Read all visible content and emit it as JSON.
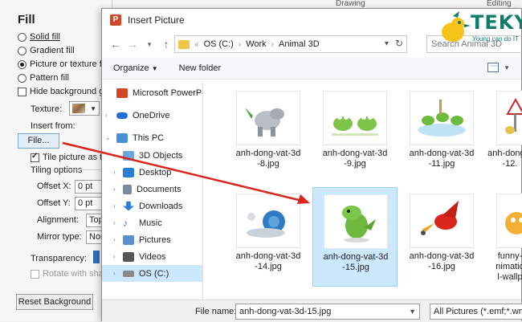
{
  "ribbon": {
    "drawing": "Drawing",
    "editing": "Editing"
  },
  "pane": {
    "title": "Fill",
    "options": [
      {
        "label": "Solid fill",
        "selected": false
      },
      {
        "label": "Gradient fill",
        "selected": false
      },
      {
        "label": "Picture or texture fill",
        "selected": true
      },
      {
        "label": "Pattern fill",
        "selected": false
      }
    ],
    "hide_background": "Hide background graphics",
    "texture_label": "Texture:",
    "insert_from": "Insert from:",
    "file_button": "File...",
    "tile_picture": "Tile picture as texture",
    "tiling_options": "Tiling options",
    "offset_x_label": "Offset X:",
    "offset_x_value": "0 pt",
    "offset_y_label": "Offset Y:",
    "offset_y_value": "0 pt",
    "alignment_label": "Alignment:",
    "alignment_value": "Top left",
    "mirror_label": "Mirror type:",
    "mirror_value": "None",
    "transparency_label": "Transparency:",
    "rotate_with_shape": "Rotate with shape",
    "reset_button": "Reset Background"
  },
  "dialog": {
    "title": "Insert Picture",
    "app_icon_letter": "P",
    "address": {
      "prefix": "«",
      "parts": [
        "OS (C:)",
        "Work",
        "Animal 3D"
      ]
    },
    "search_placeholder": "Search Animal 3D",
    "toolbar": {
      "organize": "Organize",
      "new_folder": "New folder"
    },
    "nav_items": [
      {
        "label": "Microsoft PowerPoint",
        "icon": "powerpoint-icon",
        "color": "#d24726"
      },
      {
        "label": "OneDrive",
        "icon": "cloud-icon",
        "color": "#1e6fd9"
      },
      {
        "label": "This PC",
        "icon": "computer-icon",
        "color": "#4a90d9"
      },
      {
        "label": "3D Objects",
        "icon": "cube-icon",
        "color": "#6aa7e0"
      },
      {
        "label": "Desktop",
        "icon": "desktop-icon",
        "color": "#2a7fd4"
      },
      {
        "label": "Documents",
        "icon": "document-icon",
        "color": "#7a8aa0"
      },
      {
        "label": "Downloads",
        "icon": "download-icon",
        "color": "#2a7fd4"
      },
      {
        "label": "Music",
        "icon": "music-icon",
        "color": "#3b78c8"
      },
      {
        "label": "Pictures",
        "icon": "pictures-icon",
        "color": "#5b8fd0"
      },
      {
        "label": "Videos",
        "icon": "video-icon",
        "color": "#555555"
      },
      {
        "label": "OS (C:)",
        "icon": "drive-icon",
        "color": "#8a8a8a"
      }
    ],
    "files": [
      {
        "name1": "anh-dong-vat-3d",
        "name2": "-8.jpg",
        "thumb": "dragon-icon",
        "selected": false
      },
      {
        "name1": "anh-dong-vat-3d",
        "name2": "-9.jpg",
        "thumb": "frogs-icon",
        "selected": false
      },
      {
        "name1": "anh-dong-vat-3d",
        "name2": "-11.jpg",
        "thumb": "frogs-pond-icon",
        "selected": false
      },
      {
        "name1": "anh-dong-v",
        "name2": "-12.",
        "thumb": "bird-icon",
        "selected": false
      },
      {
        "name1": "anh-dong-vat-3d",
        "name2": "-14.jpg",
        "thumb": "snail-icon",
        "selected": false
      },
      {
        "name1": "anh-dong-vat-3d",
        "name2": "-15.jpg",
        "thumb": "green-dragon-icon",
        "selected": true
      },
      {
        "name1": "anh-dong-vat-3d",
        "name2": "-16.jpg",
        "thumb": "red-dragon-icon",
        "selected": false
      },
      {
        "name1": "funny-",
        "name2": "nimatio",
        "name3": "l-wallp",
        "thumb": "cartoon-icon",
        "selected": false
      }
    ],
    "filename_label": "File name:",
    "filename_value": "anh-dong-vat-3d-15.jpg",
    "filetype_value": "All Pictures (*.emf;*.wmf;*.jpg"
  },
  "logo": {
    "text": "TEKY",
    "tagline": "Young can do IT",
    "color": "#0f7c6c"
  },
  "colors": {
    "selection": "#cce8ff",
    "arrow": "#d9261c"
  }
}
